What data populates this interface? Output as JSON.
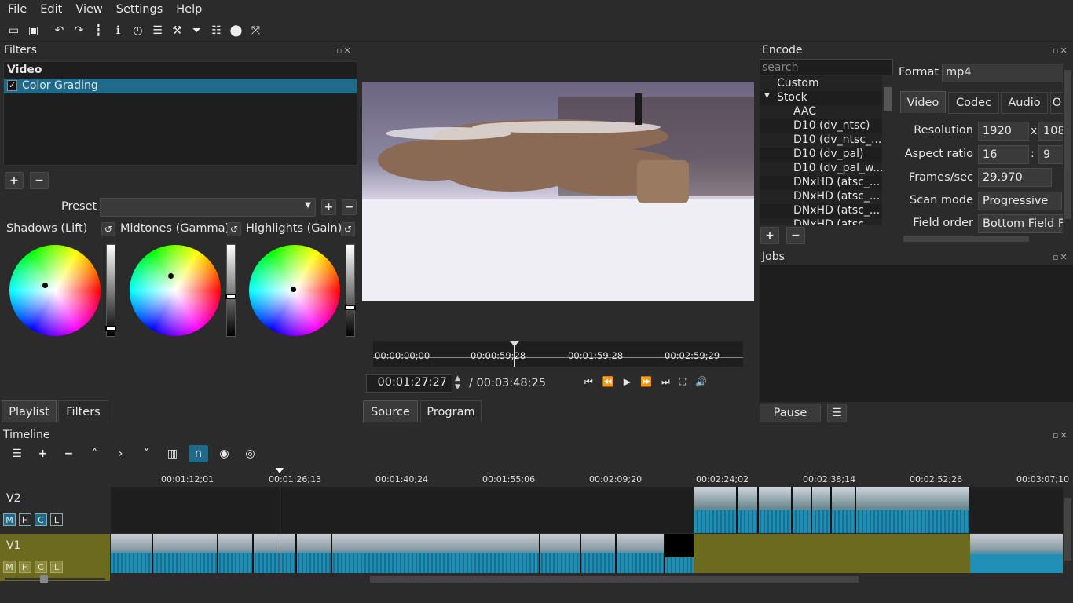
{
  "menu": [
    "File",
    "Edit",
    "View",
    "Settings",
    "Help"
  ],
  "toolbar_icons": [
    "open-icon",
    "save-icon",
    "undo-icon",
    "redo-icon",
    "peak-meter-icon",
    "properties-icon",
    "history-icon",
    "playlist-icon",
    "encode-icon",
    "filters-icon",
    "timeline-icon",
    "jobs-icon",
    "fullscreen-icon"
  ],
  "filters": {
    "title": "Filters",
    "section": "Video",
    "item": "Color Grading",
    "item_check": "✓",
    "preset_label": "Preset",
    "shadows": "Shadows (Lift)",
    "midtones": "Midtones (Gamma)",
    "highlights": "Highlights (Gain)",
    "sliders": {
      "shadows": 0.95,
      "midtones": 0.57,
      "highlights": 0.7
    },
    "tabs": [
      "Playlist",
      "Filters"
    ]
  },
  "player": {
    "ruler": [
      "00:00:00;00",
      "00:00:59;28",
      "00:01:59;28",
      "00:02:59;29"
    ],
    "current_time": "00:01:27;27",
    "total_time": "/ 00:03:48;25",
    "tabs": [
      "Source",
      "Program"
    ]
  },
  "encode": {
    "title": "Encode",
    "search_placeholder": "search",
    "presets": [
      "Custom",
      "Stock",
      "AAC",
      "D10 (dv_ntsc)",
      "D10 (dv_ntsc_...",
      "D10 (dv_pal)",
      "D10 (dv_pal_w...",
      "DNxHD (atsc_...",
      "DNxHD (atsc_...",
      "DNxHD (atsc_...",
      "DNxHD (atsc_..."
    ],
    "format_label": "Format",
    "format_value": "mp4",
    "tabs": [
      "Video",
      "Codec",
      "Audio",
      "O"
    ],
    "resolution_label": "Resolution",
    "res_w": "1920",
    "res_x": "x",
    "res_h": "108",
    "aspect_label": "Aspect ratio",
    "aspect_w": "16",
    "aspect_colon": ":",
    "aspect_h": "9",
    "fps_label": "Frames/sec",
    "fps_value": "29.970",
    "scan_label": "Scan mode",
    "scan_value": "Progressive",
    "field_label": "Field order",
    "field_value": "Bottom Field Fi"
  },
  "jobs": {
    "title": "Jobs",
    "pause": "Pause"
  },
  "timeline": {
    "title": "Timeline",
    "ruler": [
      "00:01:12;01",
      "00:01:26;13",
      "00:01:40;24",
      "00:01:55;06",
      "00:02:09;20",
      "00:02:24;02",
      "00:02:38;14",
      "00:02:52;26",
      "00:03:07;10"
    ],
    "tracks": [
      {
        "name": "V2",
        "buttons": [
          "M",
          "H",
          "C",
          "L"
        ]
      },
      {
        "name": "V1",
        "buttons": [
          "M",
          "H",
          "C",
          "L"
        ]
      }
    ]
  },
  "colors": {
    "accent": "#1d6a8a",
    "clip": "#1f8fb5",
    "track_v1": "#6b6a1f",
    "selected": "#1d6a8a"
  }
}
